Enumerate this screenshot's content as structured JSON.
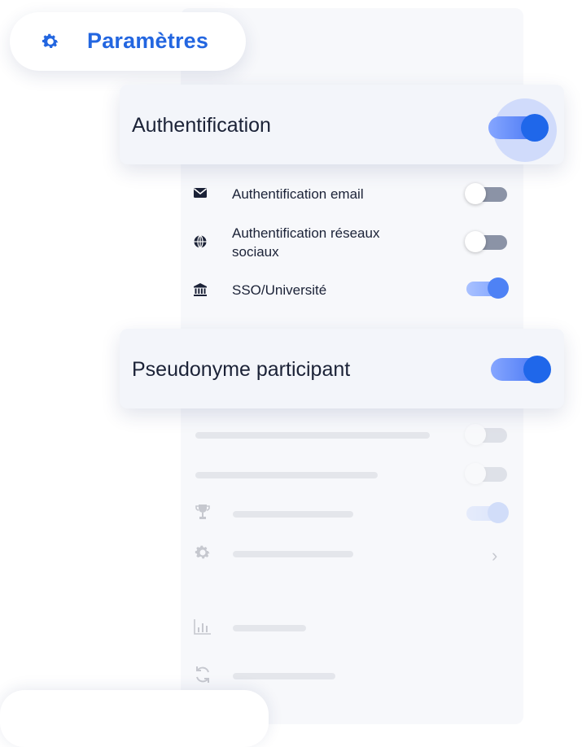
{
  "header": {
    "title": "Paramètres",
    "icon": "gear-icon",
    "accent": "#2366e0"
  },
  "auth_card": {
    "label": "Authentification",
    "enabled": true
  },
  "auth_options": [
    {
      "icon": "envelope-icon",
      "label": "Authentification email",
      "enabled": false
    },
    {
      "icon": "globe-icon",
      "label_line1": "Authentification réseaux",
      "label_line2": "sociaux",
      "enabled": false
    },
    {
      "icon": "bank-icon",
      "label": "SSO/Université",
      "enabled": true
    }
  ],
  "pseudonym_card": {
    "label": "Pseudonyme participant",
    "enabled": true
  },
  "faded_rows": [
    {
      "icon": "",
      "toggle": "off"
    },
    {
      "icon": "",
      "toggle": "off"
    },
    {
      "icon": "trophy-icon",
      "toggle": "on"
    },
    {
      "icon": "gear-icon",
      "toggle": "chevron"
    },
    {
      "icon": "bar-chart-icon",
      "toggle": "none"
    },
    {
      "icon": "refresh-icon",
      "toggle": "none"
    }
  ],
  "chevron": "›"
}
